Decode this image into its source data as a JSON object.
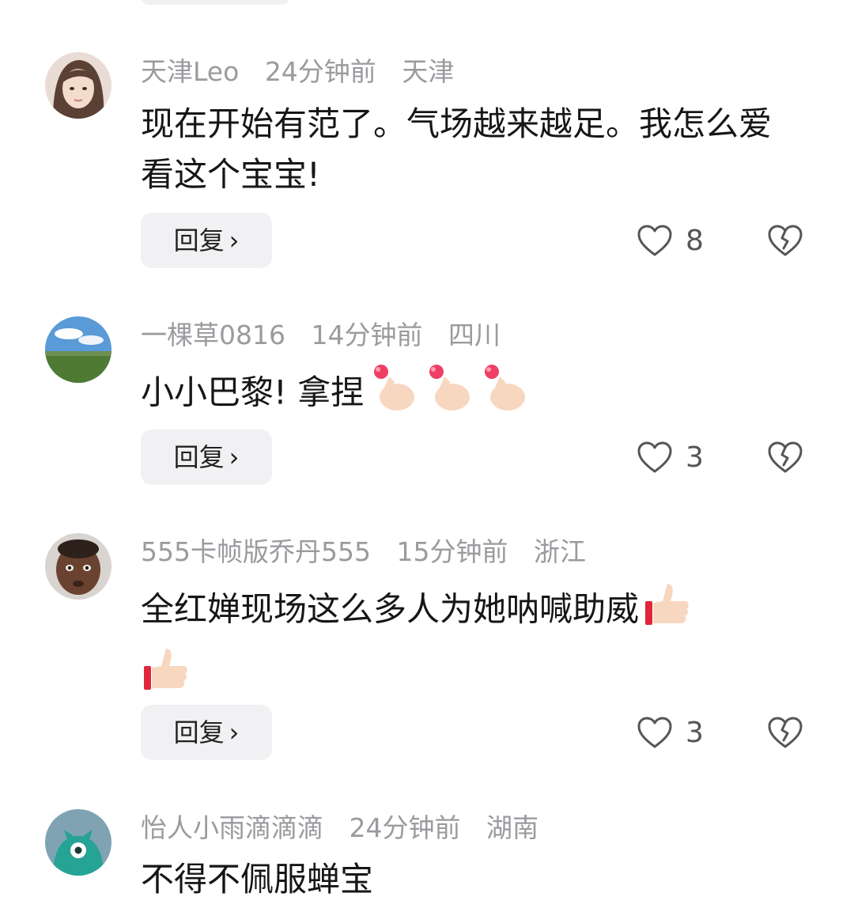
{
  "comments": [
    {
      "username": "天津Leo",
      "time": "24分钟前",
      "location": "天津",
      "text": "现在开始有范了。气场越来越足。我怎么爱看这个宝宝!",
      "reply_label": "回复",
      "likes": "8"
    },
    {
      "username": "一棵草0816",
      "time": "14分钟前",
      "location": "四川",
      "text": "小小巴黎! 拿捏",
      "reply_label": "回复",
      "likes": "3"
    },
    {
      "username": "555卡帧版乔丹555",
      "time": "15分钟前",
      "location": "浙江",
      "text": "全红婵现场这么多人为她呐喊助威",
      "reply_label": "回复",
      "likes": "3"
    },
    {
      "username": "怡人小雨滴滴滴",
      "time": "24分钟前",
      "location": "湖南",
      "text": "不得不佩服蝉宝"
    }
  ],
  "icons": {
    "like": "heart-outline-icon",
    "dislike": "broken-heart-icon",
    "reply_chevron": "chevron-right-icon",
    "emoji_finger_heart": "finger-heart-emoji",
    "emoji_thumbs_up": "thumbs-up-emoji"
  },
  "colors": {
    "meta_text": "#9a9a9f",
    "body_text": "#161616",
    "reply_bg": "#f1f1f3",
    "icon_stroke": "#555555"
  }
}
